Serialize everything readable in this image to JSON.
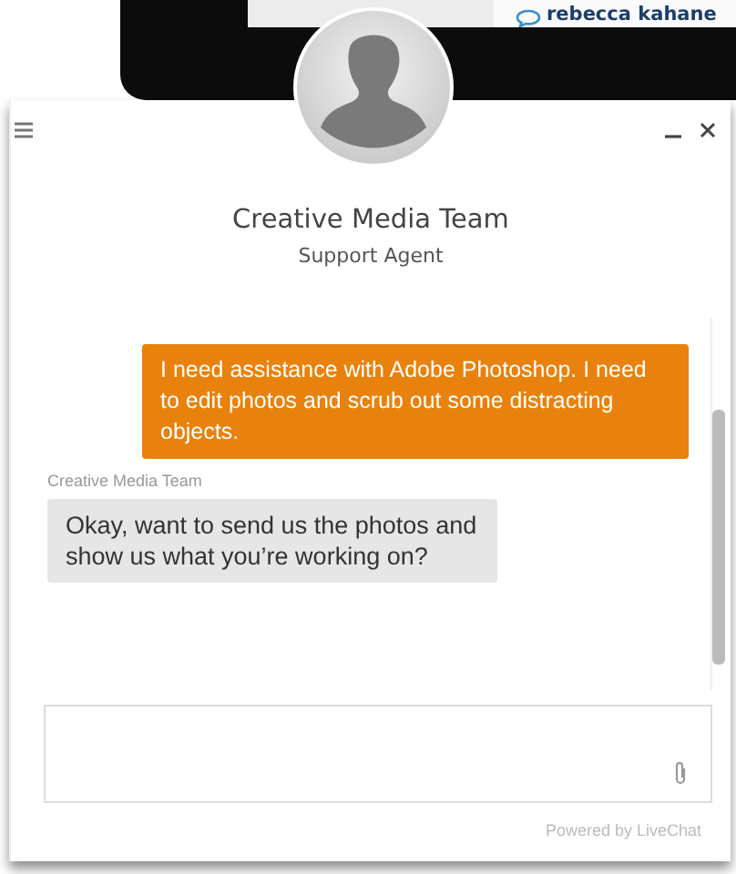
{
  "background_window": {
    "label": "rebecca kahane"
  },
  "chat": {
    "title": "Creative Media Team",
    "subtitle": "Support Agent",
    "messages": [
      {
        "kind": "visitor",
        "text": "I need assistance with Adobe Photoshop. I need to edit photos and scrub out some distracting objects."
      },
      {
        "kind": "agent",
        "author": "Creative Media Team",
        "text": "Okay, want to send us the photos and show us what you’re working on?"
      }
    ],
    "footer": "Powered by LiveChat"
  }
}
